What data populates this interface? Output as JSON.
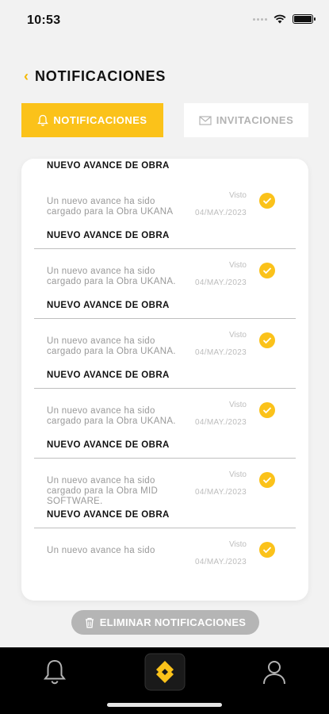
{
  "status_bar": {
    "time": "10:53"
  },
  "header": {
    "back_icon": "‹",
    "title": "NOTIFICACIONES"
  },
  "tabs": [
    {
      "label": "NOTIFICACIONES",
      "icon": "bell-icon",
      "active": true
    },
    {
      "label": "INVITACIONES",
      "icon": "envelope-icon",
      "active": false
    }
  ],
  "notifications": [
    {
      "title": "NUEVO AVANCE DE OBRA",
      "body": "Un nuevo avance ha sido cargado para la Obra UKANA",
      "status": "Visto",
      "date": "04/MAY./2023"
    },
    {
      "title": "NUEVO AVANCE DE OBRA",
      "body": "Un nuevo avance ha sido cargado para la Obra UKANA.",
      "status": "Visto",
      "date": "04/MAY./2023"
    },
    {
      "title": "NUEVO AVANCE DE OBRA",
      "body": "Un nuevo avance ha sido cargado para la Obra UKANA.",
      "status": "Visto",
      "date": "04/MAY./2023"
    },
    {
      "title": "NUEVO AVANCE DE OBRA",
      "body": "Un nuevo avance ha sido cargado para la Obra UKANA.",
      "status": "Visto",
      "date": "04/MAY./2023"
    },
    {
      "title": "NUEVO AVANCE DE OBRA",
      "body": "Un nuevo avance ha sido cargado para la Obra MID SOFTWARE.",
      "status": "Visto",
      "date": "04/MAY./2023"
    },
    {
      "title": "NUEVO AVANCE DE OBRA",
      "body": "Un nuevo avance ha sido",
      "status": "Visto",
      "date": "04/MAY./2023"
    }
  ],
  "delete_button": {
    "label": "ELIMINAR NOTIFICACIONES",
    "icon": "trash-icon"
  },
  "bottom_nav": [
    {
      "icon": "bell-icon"
    },
    {
      "icon": "app-logo-icon"
    },
    {
      "icon": "user-icon"
    }
  ],
  "colors": {
    "accent": "#fbc21a",
    "background": "#f2f2f2",
    "nav": "#000000"
  }
}
